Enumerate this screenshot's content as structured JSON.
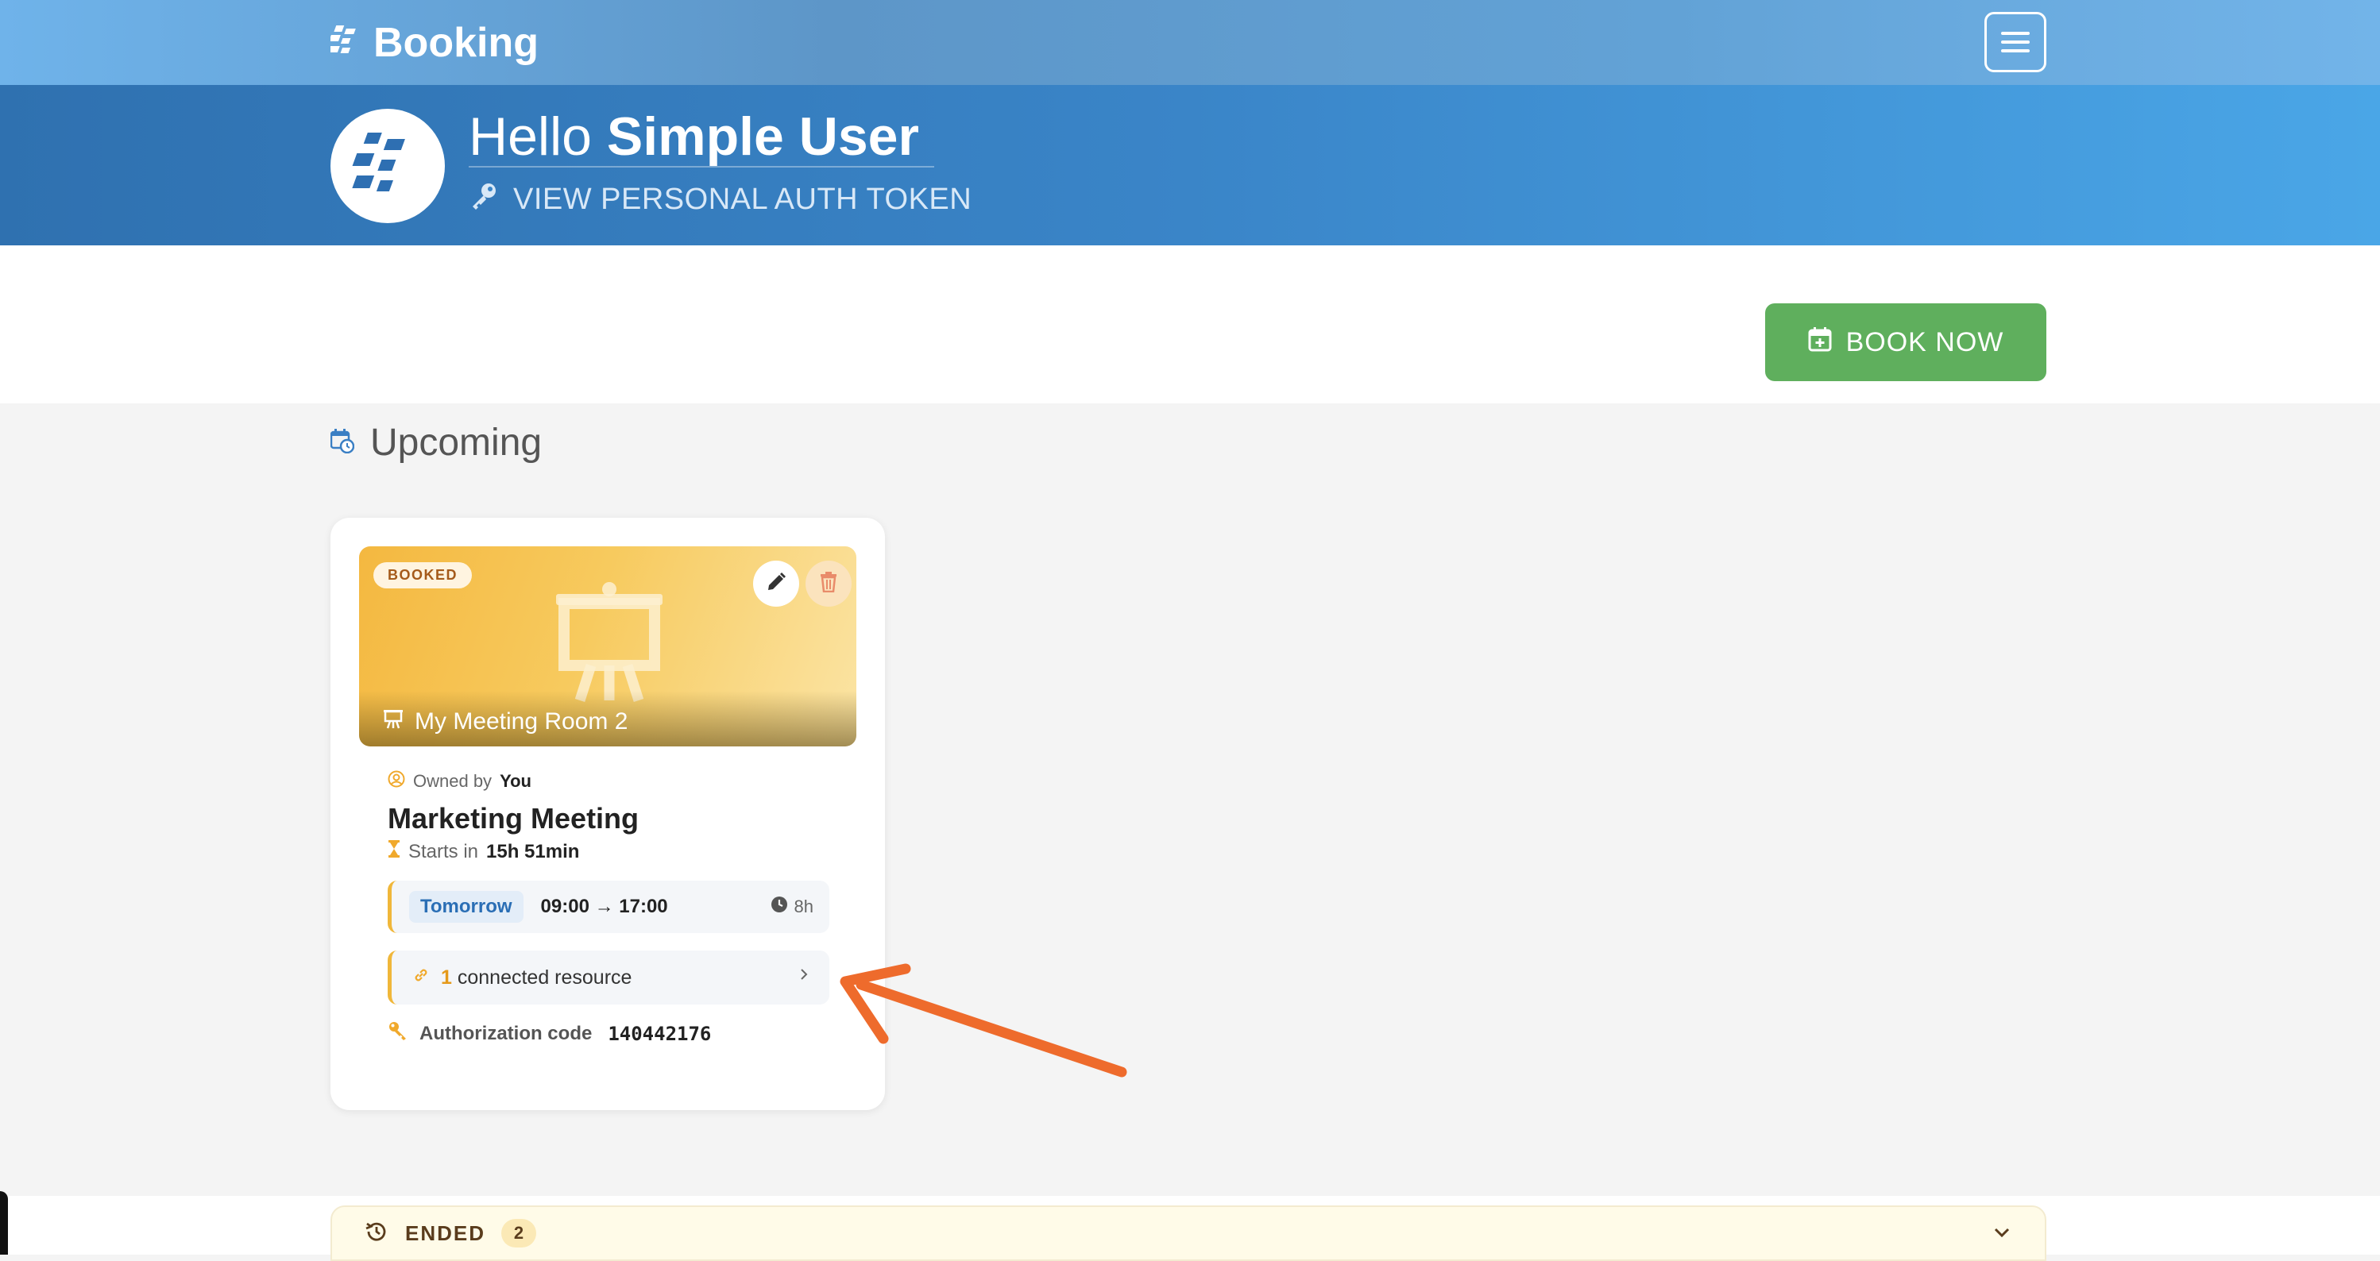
{
  "navbar": {
    "brand_name": "Booking",
    "brand_icon": "booking-logo",
    "menu_icon": "hamburger-icon"
  },
  "hero": {
    "greeting": "Hello",
    "user_name": "Simple User",
    "token_link": "VIEW PERSONAL AUTH TOKEN"
  },
  "actions": {
    "book_now": "BOOK NOW"
  },
  "upcoming": {
    "section_title": "Upcoming",
    "card": {
      "status": "BOOKED",
      "room_name": "My Meeting Room 2",
      "owned_prefix": "Owned by",
      "owner": "You",
      "title": "Marketing Meeting",
      "starts_prefix": "Starts in",
      "starts_in": "15h 51min",
      "day": "Tomorrow",
      "time_range": "09:00 → 17:00",
      "duration": "8h",
      "resource_count": "1",
      "resource_label": "connected resource",
      "auth_label": "Authorization code",
      "auth_code": "140442176"
    }
  },
  "ended": {
    "label": "ENDED",
    "count": "2"
  },
  "colors": {
    "accent_blue": "#3a85c8",
    "book_green": "#5faf5d",
    "booked_amber": "#f0b73a",
    "annotation_arrow": "#ee6b2c"
  }
}
